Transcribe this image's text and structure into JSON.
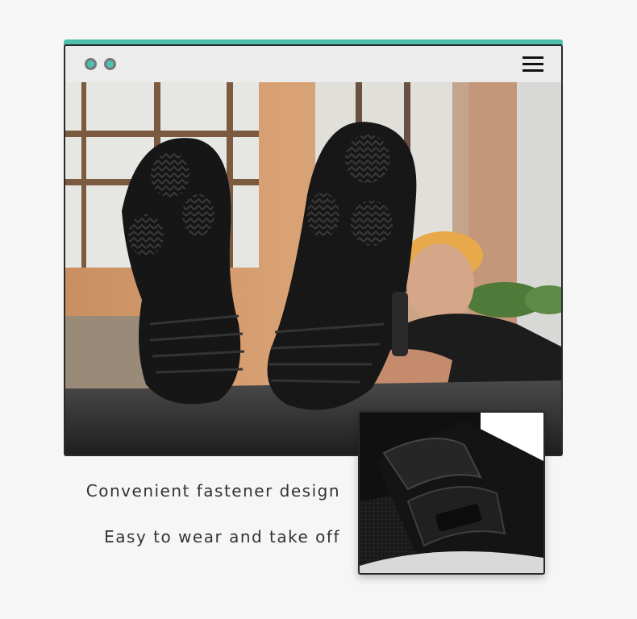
{
  "window": {
    "menu_icon": "hamburger-menu-icon",
    "accent_color": "#4dbfae",
    "dot_count": 2
  },
  "photo": {
    "subject": "black-sandal-soles-photo"
  },
  "captions": [
    "Convenient fastener design",
    "Easy to wear and take off"
  ],
  "inset": {
    "subject": "buckle-fastener-closeup"
  }
}
